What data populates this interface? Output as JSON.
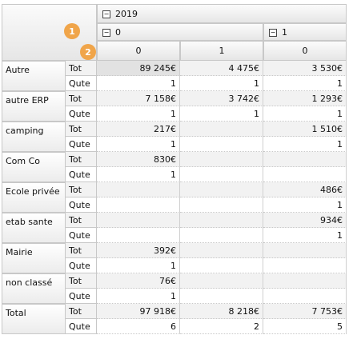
{
  "header": {
    "year": "2019",
    "groups": [
      "0",
      "1"
    ],
    "columns": [
      "0",
      "1",
      "0"
    ],
    "badges": [
      "1",
      "2"
    ],
    "toggle_icon": "⊟"
  },
  "rows": [
    {
      "label": "Autre",
      "tot": [
        "89 245€",
        "4 475€",
        "3 530€"
      ],
      "qte": [
        "1",
        "1",
        "1"
      ]
    },
    {
      "label": "autre ERP",
      "tot": [
        "7 158€",
        "3 742€",
        "1 293€"
      ],
      "qte": [
        "1",
        "1",
        "1"
      ]
    },
    {
      "label": "camping",
      "tot": [
        "217€",
        "",
        "1 510€"
      ],
      "qte": [
        "1",
        "",
        "1"
      ]
    },
    {
      "label": "Com Co",
      "tot": [
        "830€",
        "",
        ""
      ],
      "qte": [
        "1",
        "",
        ""
      ]
    },
    {
      "label": "Ecole privée",
      "tot": [
        "",
        "",
        "486€"
      ],
      "qte": [
        "",
        "",
        "1"
      ]
    },
    {
      "label": "etab sante",
      "tot": [
        "",
        "",
        "934€"
      ],
      "qte": [
        "",
        "",
        "1"
      ]
    },
    {
      "label": "Mairie",
      "tot": [
        "392€",
        "",
        ""
      ],
      "qte": [
        "1",
        "",
        ""
      ]
    },
    {
      "label": "non classé",
      "tot": [
        "76€",
        "",
        ""
      ],
      "qte": [
        "1",
        "",
        ""
      ]
    },
    {
      "label": "Total",
      "tot": [
        "97 918€",
        "8 218€",
        "7 753€"
      ],
      "qte": [
        "6",
        "2",
        "5"
      ]
    }
  ],
  "measures": {
    "tot": "Tot",
    "qte": "Qute"
  }
}
